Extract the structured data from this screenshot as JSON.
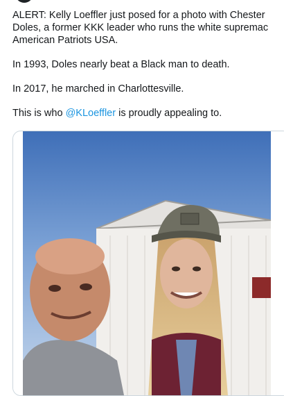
{
  "tweet": {
    "paragraphs": {
      "p1": "ALERT: Kelly Loeffler just posed for a photo with Chester Doles, a former KKK leader who runs the white supremacist group American Patriots USA.",
      "p1_line1": "ALERT: Kelly Loeffler just posed for a photo with Chester",
      "p1_line2": "Doles, a former KKK leader who runs the white supremac",
      "p1_line3": "American Patriots USA.",
      "p2": "In 1993, Doles nearly beat a Black man to death.",
      "p3": "In 2017, he marched in Charlottesville.",
      "p4_before": "This is who ",
      "p4_mention": "@KLoeffler",
      "p4_after": " is proudly appealing to."
    },
    "colors": {
      "mention": "#1b95e0",
      "text": "#14171a",
      "card_border": "#ccd6dd"
    },
    "media": {
      "icon": "photo-icon"
    }
  }
}
